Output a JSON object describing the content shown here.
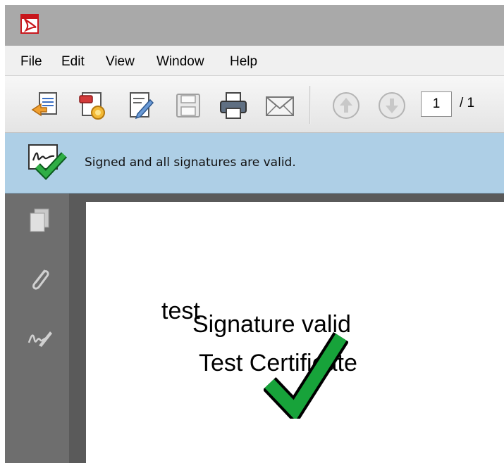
{
  "menu": [
    "File",
    "Edit",
    "View",
    "Window",
    "Help"
  ],
  "toolbar": {
    "buttons": [
      "create-pdf-icon",
      "sign-certify-icon",
      "edit-icon",
      "save-icon",
      "print-icon",
      "email-icon",
      "prev-page-icon",
      "next-page-icon"
    ],
    "page_current": "1",
    "page_total": "/ 1"
  },
  "signature_bar": {
    "message": "Signed and all signatures are valid."
  },
  "left_pane": [
    "pages-icon",
    "attachments-icon",
    "signatures-icon"
  ],
  "document": {
    "text_test": "test",
    "text_signature_valid": "Signature valid",
    "text_certificate": "Test Certificate"
  },
  "colors": {
    "sig_bar": "#aecfe6",
    "checkmark": "#1aa33a",
    "left_pane": "#6e6e6e"
  }
}
